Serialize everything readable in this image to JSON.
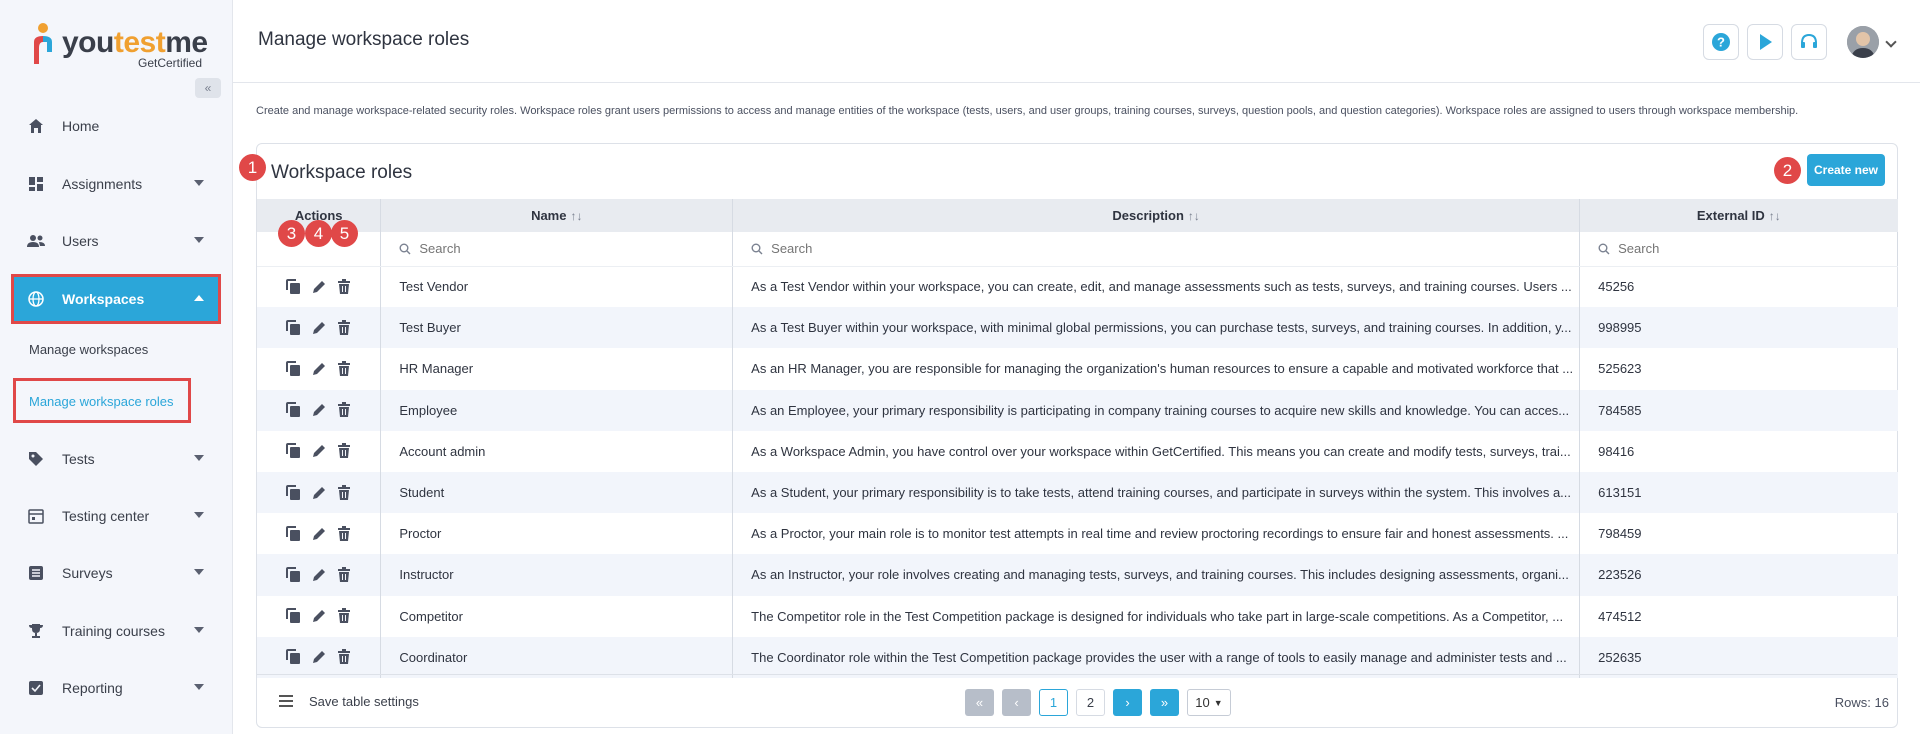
{
  "brand": {
    "name_a": "you",
    "name_b": "test",
    "name_c": "me",
    "sub": "GetCertified"
  },
  "sidebar": {
    "collapse_icon": "double-chevron-left-icon",
    "items": [
      {
        "label": "Home",
        "icon": "home-icon"
      },
      {
        "label": "Assignments",
        "icon": "dashboard-icon"
      },
      {
        "label": "Users",
        "icon": "users-icon"
      },
      {
        "label": "Workspaces",
        "icon": "globe-icon"
      },
      {
        "label": "Tests",
        "icon": "tag-icon"
      },
      {
        "label": "Testing center",
        "icon": "calendar-icon"
      },
      {
        "label": "Surveys",
        "icon": "list-icon"
      },
      {
        "label": "Training courses",
        "icon": "trophy-icon"
      },
      {
        "label": "Reporting",
        "icon": "report-icon"
      }
    ],
    "sub_items": [
      {
        "label": "Manage workspaces"
      },
      {
        "label": "Manage workspace roles"
      }
    ]
  },
  "header": {
    "title": "Manage workspace roles",
    "buttons": [
      "help-icon",
      "play-icon",
      "support-icon"
    ]
  },
  "intro": "Create and manage workspace-related security roles. Workspace roles grant users permissions to access and manage entities of the workspace (tests, users, and user groups, training courses, surveys, question pools, and question categories). Workspace roles are assigned to users through workspace membership.",
  "card": {
    "title": "Workspace roles",
    "create_label": "Create new",
    "badges": [
      "1",
      "2",
      "3",
      "4",
      "5"
    ]
  },
  "table": {
    "columns": [
      "Actions",
      "Name",
      "Description",
      "External ID"
    ],
    "search_placeholder": "Search",
    "rows": [
      {
        "name": "Test Vendor",
        "description": "As a Test Vendor within your workspace, you can create, edit, and manage assessments such as tests, surveys, and training courses. Users ...",
        "external_id": "45256"
      },
      {
        "name": "Test Buyer",
        "description": "As a Test Buyer within your workspace, with minimal global permissions, you can purchase tests, surveys, and training courses. In addition, y...",
        "external_id": "998995"
      },
      {
        "name": "HR Manager",
        "description": "As an HR Manager, you are responsible for managing the organization's human resources to ensure a capable and motivated workforce that ...",
        "external_id": "525623"
      },
      {
        "name": "Employee",
        "description": "As an Employee, your primary responsibility is participating in company training courses to acquire new skills and knowledge. You can acces...",
        "external_id": "784585"
      },
      {
        "name": "Account admin",
        "description": "As a Workspace Admin, you have control over your workspace within GetCertified. This means you can create and modify tests, surveys, trai...",
        "external_id": "98416"
      },
      {
        "name": "Student",
        "description": "As a Student, your primary responsibility is to take tests, attend training courses, and participate in surveys within the system. This involves a...",
        "external_id": "613151"
      },
      {
        "name": "Proctor",
        "description": "As a Proctor, your main role is to monitor test attempts in real time and review proctoring recordings to ensure fair and honest assessments. ...",
        "external_id": "798459"
      },
      {
        "name": "Instructor",
        "description": "As an Instructor, your role involves creating and managing tests, surveys, and training courses. This includes designing assessments, organi...",
        "external_id": "223526"
      },
      {
        "name": "Competitor",
        "description": "The Competitor role in the Test Competition package is designed for individuals who take part in large-scale competitions. As a Competitor, ...",
        "external_id": "474512"
      },
      {
        "name": "Coordinator",
        "description": "The Coordinator role within the Test Competition package provides the user with a range of tools to easily manage and administer tests and ...",
        "external_id": "252635"
      }
    ]
  },
  "footer": {
    "settings_label": "Save table settings",
    "pages": [
      "1",
      "2"
    ],
    "page_size": "10",
    "rows_label": "Rows: 16"
  },
  "colors": {
    "accent": "#2ba6d9",
    "highlight": "#e04848"
  }
}
